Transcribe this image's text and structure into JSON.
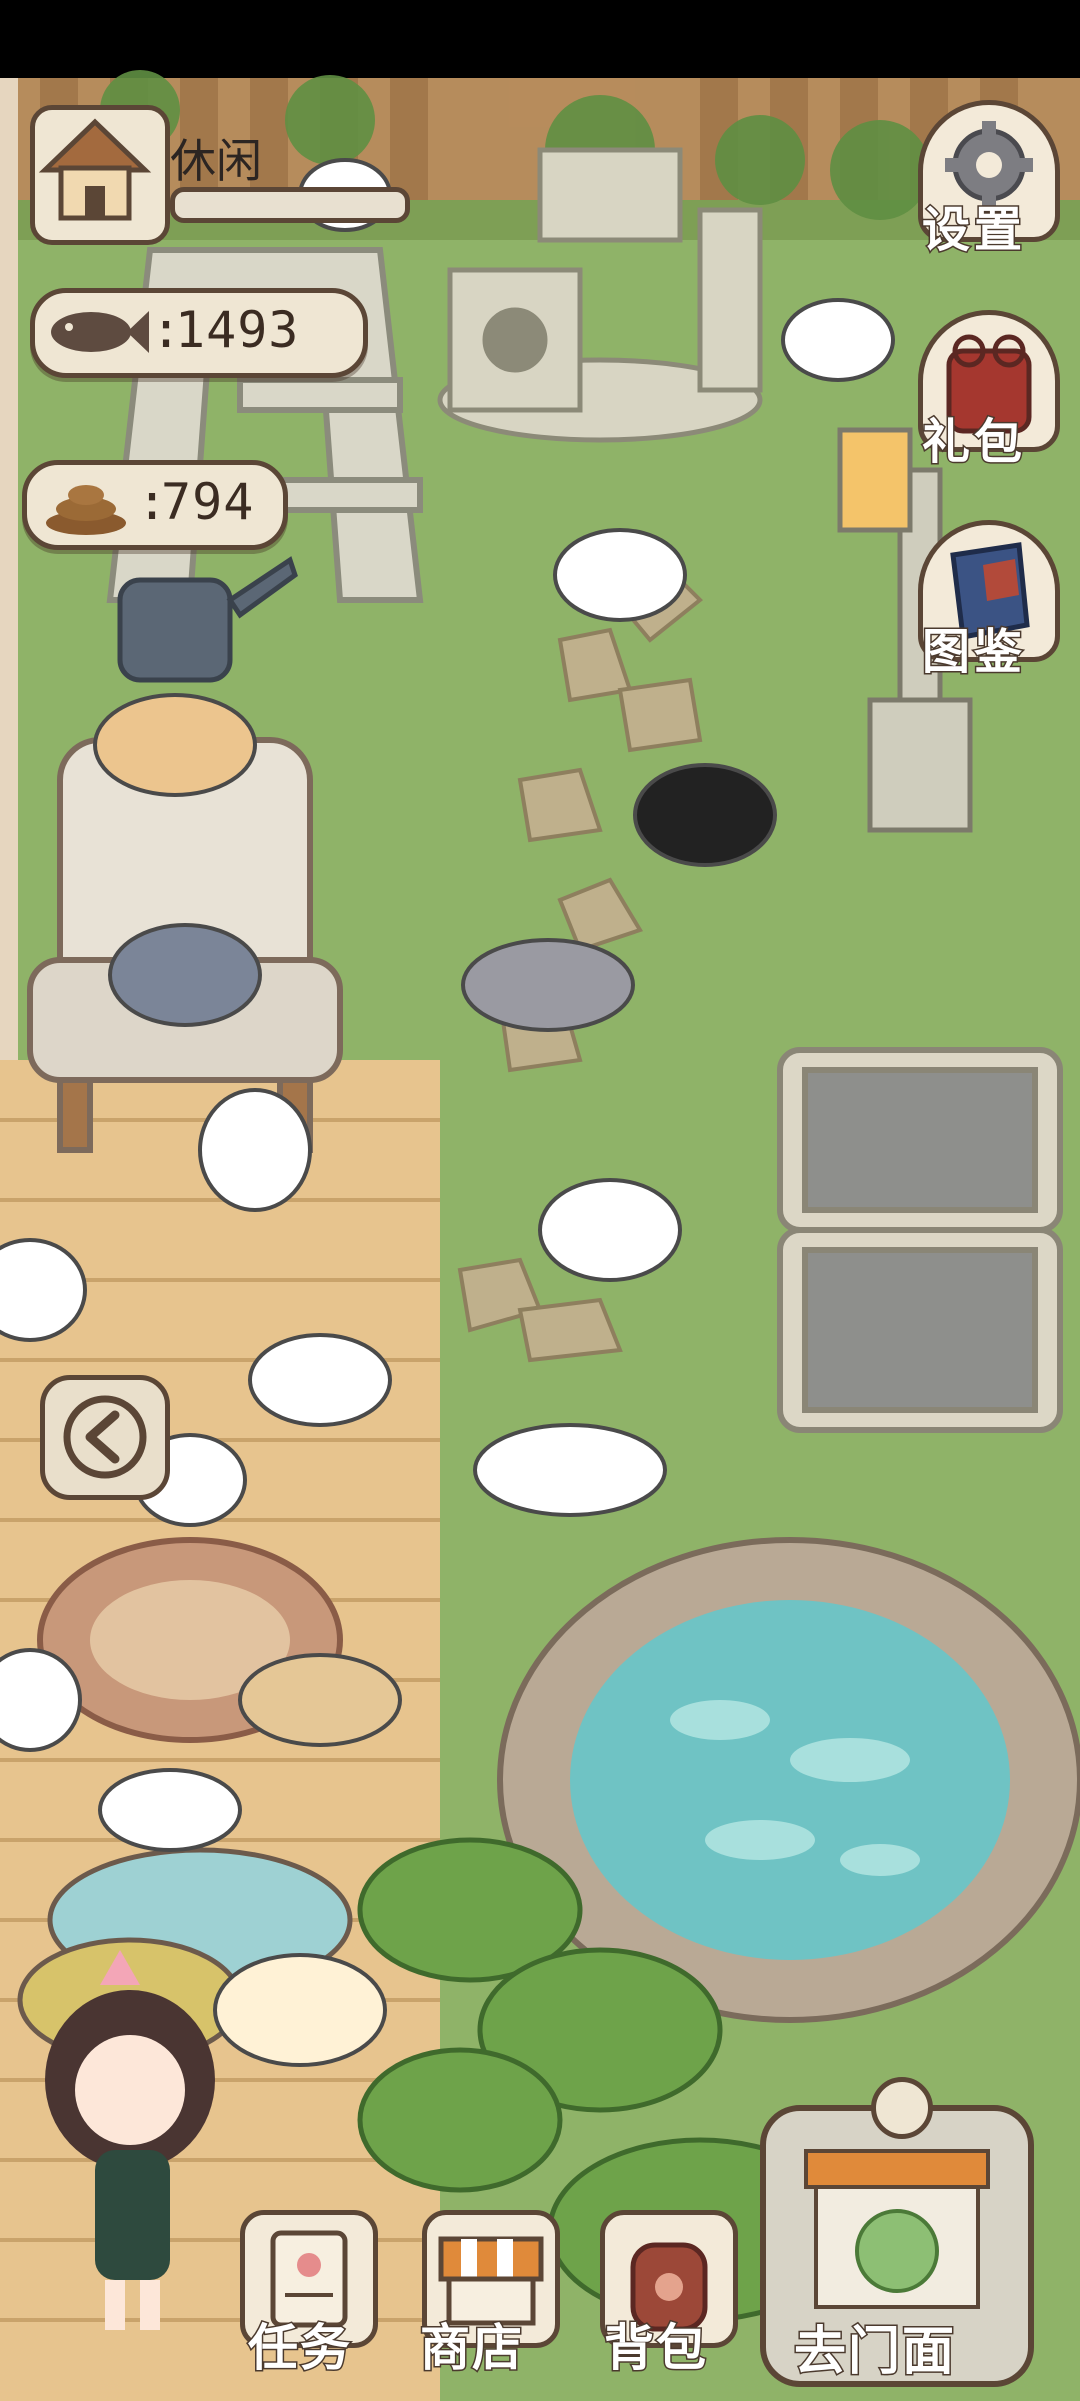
{
  "hud": {
    "status_label": "休闲",
    "fish_count": "1493",
    "poop_count": "794",
    "colon": ":"
  },
  "side_menu": {
    "settings_label": "设置",
    "gift_label": "礼包",
    "catalog_label": "图鉴"
  },
  "bottom_menu": {
    "task_label": "任务",
    "shop_label": "商店",
    "bag_label": "背包",
    "store_label": "去门面"
  },
  "colors": {
    "outline": "#5b4636",
    "panel": "#efe6d3",
    "grass": "#8fb368",
    "path": "#d9b88a",
    "water": "#6fc3c4"
  },
  "icons": {
    "house": "house-icon",
    "fish": "fish-icon",
    "poop": "poop-icon",
    "gear": "gear-icon",
    "gift": "gift-bag-icon",
    "book": "catalog-book-icon",
    "back": "chevron-left-icon"
  }
}
